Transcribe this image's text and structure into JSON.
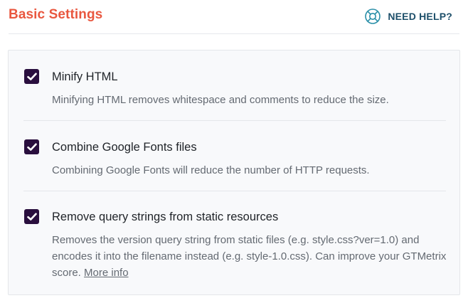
{
  "header": {
    "title": "Basic Settings",
    "help_label": "NEED HELP?",
    "help_icon": "lifebuoy-icon"
  },
  "colors": {
    "title": "#e9573f",
    "help": "#1d4f6a",
    "checkbox": "#2a0f3e",
    "panel_bg": "#f8f9fb"
  },
  "options": [
    {
      "title": "Minify HTML",
      "description": "Minifying HTML removes whitespace and comments to reduce the size.",
      "checked": true
    },
    {
      "title": "Combine Google Fonts files",
      "description": "Combining Google Fonts will reduce the number of HTTP requests.",
      "checked": true
    },
    {
      "title": "Remove query strings from static resources",
      "description": "Removes the version query string from static files (e.g. style.css?ver=1.0) and encodes it into the filename instead (e.g. style-1.0.css). Can improve your GTMetrix score.",
      "link_text": "More info",
      "checked": true
    }
  ]
}
